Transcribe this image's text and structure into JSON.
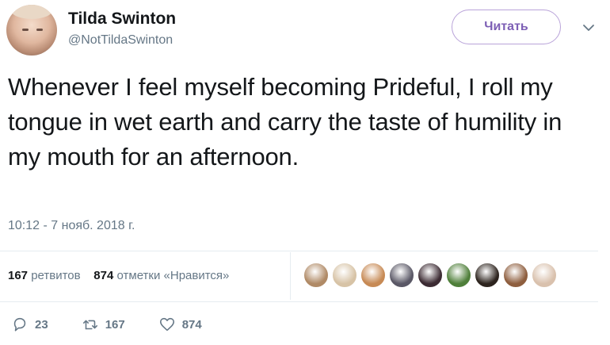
{
  "tweet": {
    "author_name": "Tilda Swinton",
    "author_handle": "@NotTildaSwinton",
    "follow_label": "Читать",
    "text": "Whenever I feel myself becoming Prideful, I roll my tongue in wet earth and carry the taste of humility in my mouth for an afternoon.",
    "timestamp": "10:12 - 7 нояб. 2018 г."
  },
  "stats": {
    "retweets_count": "167",
    "retweets_label": "ретвитов",
    "likes_count": "874",
    "likes_label": "отметки «Нравится»"
  },
  "liker_avatars": [
    {
      "name": "liker-avatar-1",
      "color": "#b08a66"
    },
    {
      "name": "liker-avatar-2",
      "color": "#d7c3a6"
    },
    {
      "name": "liker-avatar-3",
      "color": "#c78a55"
    },
    {
      "name": "liker-avatar-4",
      "color": "#5a5866"
    },
    {
      "name": "liker-avatar-5",
      "color": "#3c2b33"
    },
    {
      "name": "liker-avatar-6",
      "color": "#4f7f3a"
    },
    {
      "name": "liker-avatar-7",
      "color": "#2d241e"
    },
    {
      "name": "liker-avatar-8",
      "color": "#8e5e3e"
    },
    {
      "name": "liker-avatar-9",
      "color": "#d9c1ad"
    }
  ],
  "actions": {
    "reply_count": "23",
    "retweet_count": "167",
    "like_count": "874"
  },
  "colors": {
    "text_primary": "#14171a",
    "text_secondary": "#657786",
    "follow_accent": "#7d5fb5",
    "divider": "#e6ecf0"
  }
}
